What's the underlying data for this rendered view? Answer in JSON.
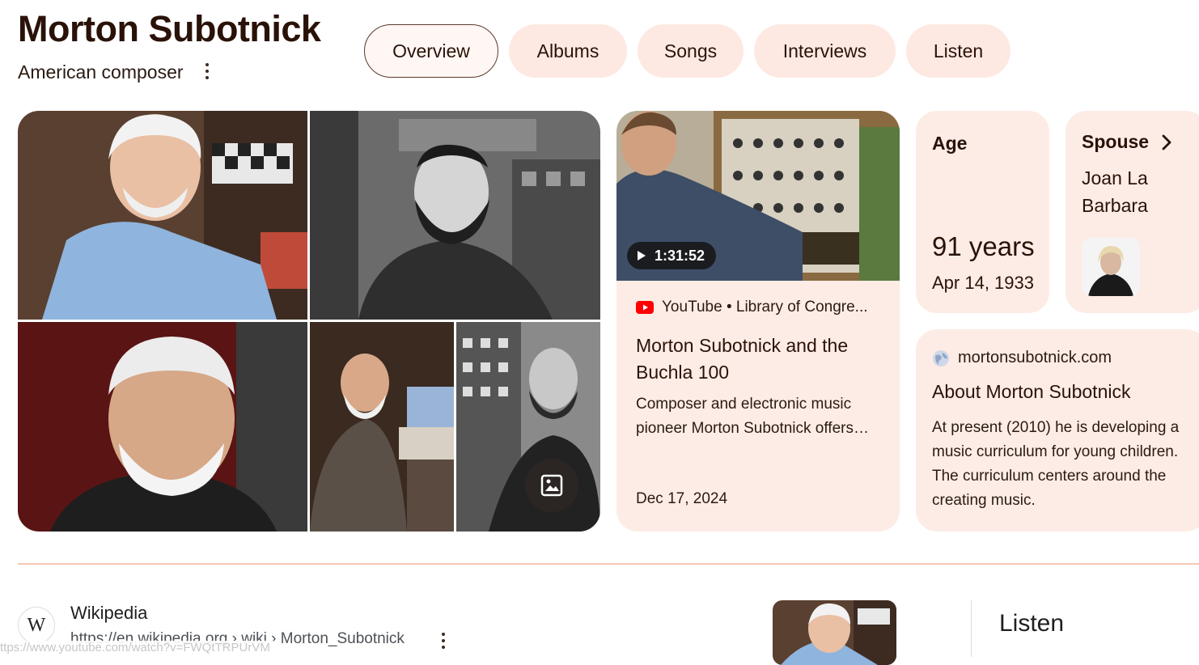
{
  "entity": {
    "name": "Morton Subotnick",
    "description": "American composer"
  },
  "tabs": [
    {
      "label": "Overview",
      "active": true
    },
    {
      "label": "Albums",
      "active": false
    },
    {
      "label": "Songs",
      "active": false
    },
    {
      "label": "Interviews",
      "active": false
    },
    {
      "label": "Listen",
      "active": false
    }
  ],
  "video": {
    "duration": "1:31:52",
    "source": "YouTube • Library of Congre...",
    "title": "Morton Subotnick and the Buchla 100",
    "description_lines": [
      "Composer and electronic music",
      "pioneer Morton Subotnick offers…"
    ],
    "date": "Dec 17, 2024"
  },
  "age": {
    "label": "Age",
    "value": "91 years",
    "birth_date": "Apr 14, 1933"
  },
  "spouse": {
    "label": "Spouse",
    "name": "Joan La Barbara"
  },
  "about": {
    "site": "mortonsubotnick.com",
    "title": "About Morton Subotnick",
    "text": "At present (2010) he is developing a music curriculum for young children. The curriculum centers around the creating music."
  },
  "result": {
    "site_name": "Wikipedia",
    "logo_letter": "W",
    "url": "https://en.wikipedia.org › wiki › Morton_Subotnick"
  },
  "listen_panel": {
    "title": "Listen"
  },
  "status_bar": {
    "url": "ttps://www.youtube.com/watch?v=FWQtTRPUrVM"
  },
  "colors": {
    "card_bg": "#fdece5",
    "title_text": "#2a1208",
    "divider": "#f7c6b1",
    "youtube_red": "#ff0000"
  },
  "icons": [
    "more-vert-icon",
    "play-icon",
    "youtube-icon",
    "chevron-right-icon",
    "globe-icon",
    "images-icon"
  ]
}
